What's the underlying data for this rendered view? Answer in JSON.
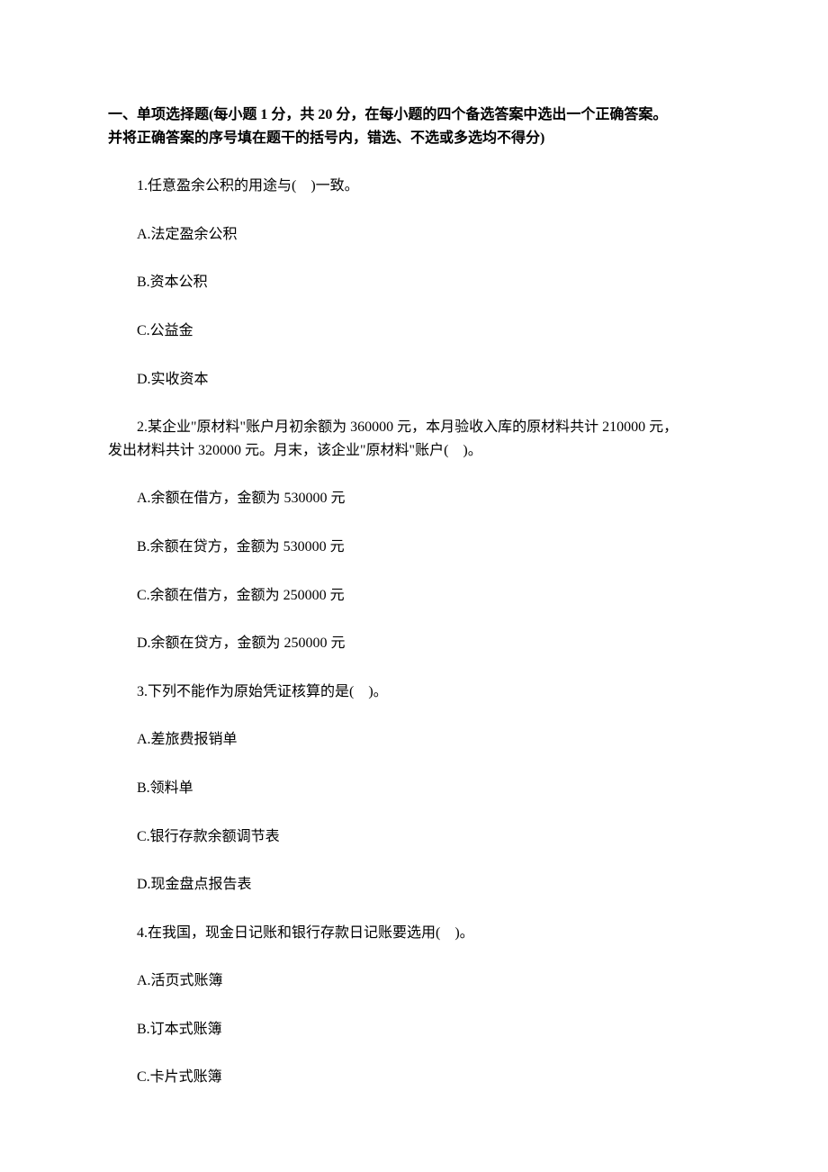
{
  "section_header_line1": "一、单项选择题(每小题 1 分，共 20 分，在每小题的四个备选答案中选出一个正确答案。",
  "section_header_line2": "并将正确答案的序号填在题干的括号内，错选、不选或多选均不得分)",
  "q1": {
    "stem": "1.任意盈余公积的用途与(　)一致。",
    "a": "A.法定盈余公积",
    "b": "B.资本公积",
    "c": "C.公益金",
    "d": "D.实收资本"
  },
  "q2": {
    "stem_line1": "2.某企业\"原材料\"账户月初余额为 360000 元，本月验收入库的原材料共计 210000 元，",
    "stem_line2": "发出材料共计 320000 元。月末，该企业\"原材料\"账户(　)。",
    "a": "A.余额在借方，金额为 530000 元",
    "b": "B.余额在贷方，金额为 530000 元",
    "c": "C.余额在借方，金额为 250000 元",
    "d": "D.余额在贷方，金额为 250000 元"
  },
  "q3": {
    "stem": "3.下列不能作为原始凭证核算的是(　)。",
    "a": "A.差旅费报销单",
    "b": "B.领料单",
    "c": "C.银行存款余额调节表",
    "d": "D.现金盘点报告表"
  },
  "q4": {
    "stem": "4.在我国，现金日记账和银行存款日记账要选用(　)。",
    "a": "A.活页式账簿",
    "b": "B.订本式账簿",
    "c": "C.卡片式账簿"
  }
}
